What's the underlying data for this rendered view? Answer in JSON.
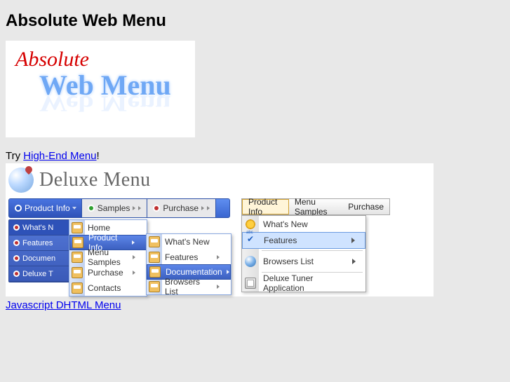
{
  "page_title": "Absolute Web Menu",
  "logo": {
    "line1": "Absolute",
    "line2": "Web Menu"
  },
  "try_prefix": "Try ",
  "try_link": "High-End Menu",
  "try_suffix": "!",
  "deluxe_title": "Deluxe Menu",
  "bluebar": {
    "product_info": "Product Info",
    "samples": "Samples",
    "purchase": "Purchase"
  },
  "blue_vertical": {
    "whatsnew": "What's N",
    "features": "Features",
    "documen": "Documen",
    "deluxet": "Deluxe T"
  },
  "flyout1": {
    "home": "Home",
    "product_info": "Product Info",
    "menu_samples": "Menu Samples",
    "purchase": "Purchase",
    "contacts": "Contacts"
  },
  "flyout2": {
    "whats_new": "What's New",
    "features": "Features",
    "documentation": "Documentation",
    "browsers_list": "Browsers List"
  },
  "gbar": {
    "product_info": "Product Info",
    "menu_samples": "Menu Samples",
    "purchase": "Purchase"
  },
  "gpanel": {
    "whats_new": "What's New",
    "features": "Features",
    "browsers_list": "Browsers List",
    "deluxe_tuner": "Deluxe Tuner Application"
  },
  "bottom_link": "Javascript DHTML Menu"
}
